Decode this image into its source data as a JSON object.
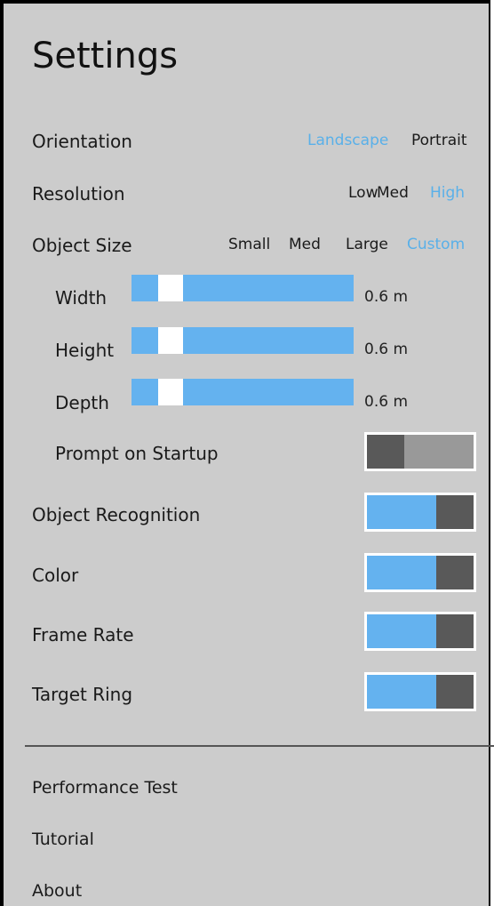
{
  "title": "Settings",
  "orientation": {
    "label": "Orientation",
    "options": [
      "Landscape",
      "Portrait"
    ],
    "selected": "Landscape"
  },
  "resolution": {
    "label": "Resolution",
    "options": [
      "Low",
      "Med",
      "High"
    ],
    "selected": "High"
  },
  "object_size": {
    "label": "Object Size",
    "options": [
      "Small",
      "Med",
      "Large",
      "Custom"
    ],
    "selected": "Custom",
    "sliders": [
      {
        "label": "Width",
        "value": "0.6 m"
      },
      {
        "label": "Height",
        "value": "0.6 m"
      },
      {
        "label": "Depth",
        "value": "0.6 m"
      }
    ],
    "prompt_on_startup": {
      "label": "Prompt on Startup",
      "state": "off"
    }
  },
  "toggles": [
    {
      "label": "Object Recognition",
      "state": "on"
    },
    {
      "label": "Color",
      "state": "on"
    },
    {
      "label": "Frame Rate",
      "state": "on"
    },
    {
      "label": "Target Ring",
      "state": "on"
    }
  ],
  "menu": [
    "Performance Test",
    "Tutorial",
    "About"
  ],
  "colors": {
    "panel": "#cccccc",
    "accent": "#59b0e9",
    "slider": "#64b2ef",
    "knob": "#595959",
    "toggle_off": "#999999"
  }
}
